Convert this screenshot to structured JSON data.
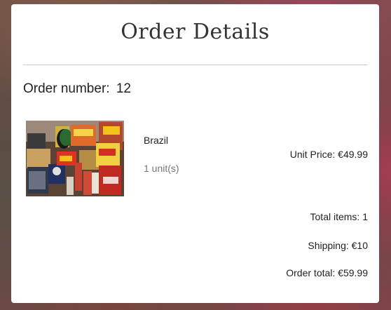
{
  "order": {
    "title": "Order Details",
    "number_label": "Order number:",
    "number": "12"
  },
  "item": {
    "name": "Brazil",
    "quantity": "1 unit(s)",
    "unit_price": "Unit Price: €49.99",
    "image_alt": "Brazilian groceries product photo"
  },
  "summary": {
    "total_items": "Total items: 1",
    "shipping": "Shipping: €10",
    "order_total": "Order total: €59.99"
  }
}
